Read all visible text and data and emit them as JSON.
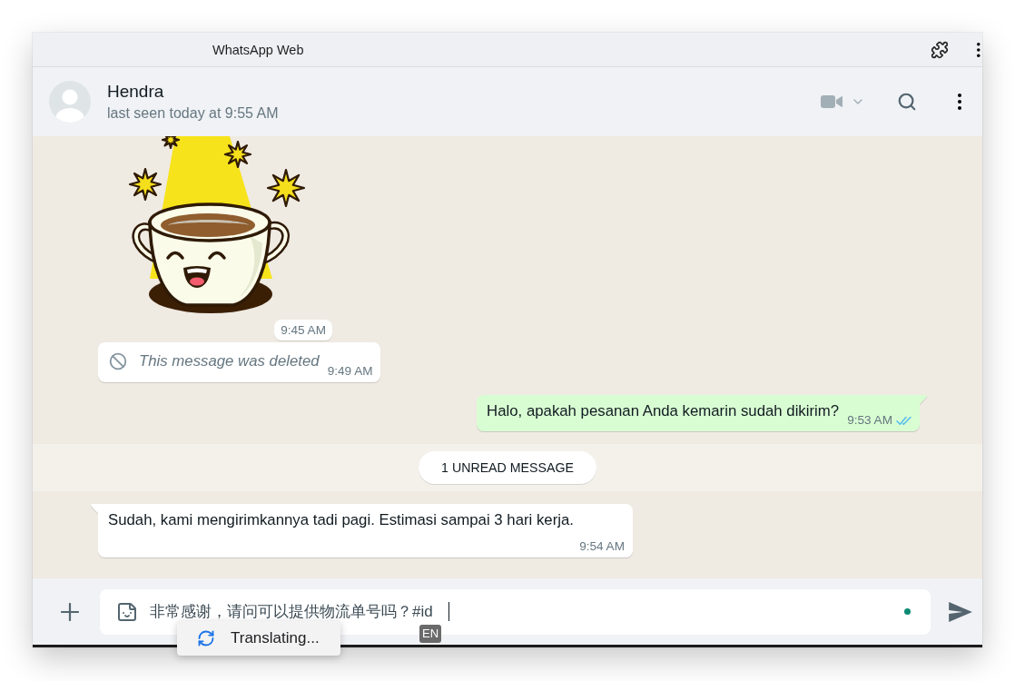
{
  "window": {
    "title": "WhatsApp Web"
  },
  "chat_header": {
    "name": "Hendra",
    "status": "last seen today at 9:55 AM"
  },
  "messages": [
    {
      "kind": "sticker",
      "outgoing": false,
      "time": "9:45 AM"
    },
    {
      "kind": "deleted",
      "outgoing": false,
      "text": "This message was deleted",
      "time": "9:49 AM"
    },
    {
      "kind": "text",
      "outgoing": true,
      "text": "Halo, apakah pesanan Anda kemarin sudah dikirim?",
      "time": "9:53 AM",
      "read": true
    },
    {
      "kind": "unread_divider",
      "text": "1 UNREAD MESSAGE"
    },
    {
      "kind": "text",
      "outgoing": false,
      "text": "Sudah, kami mengirimkannya tadi pagi. Estimasi sampai 3 hari kerja.",
      "time": "9:54 AM"
    }
  ],
  "composer": {
    "value": "非常感谢，请问可以提供物流单号吗？#id",
    "input_language": "EN",
    "popup": {
      "text": "Translating..."
    }
  }
}
